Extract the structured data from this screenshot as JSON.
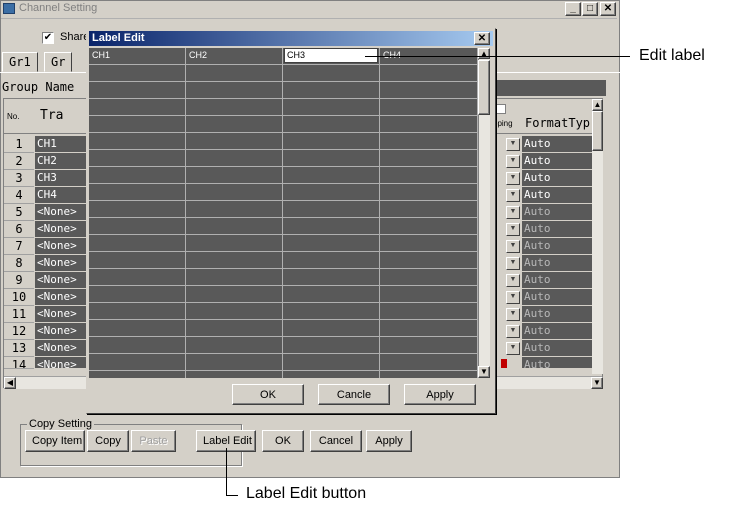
{
  "main": {
    "title": "Channel Setting",
    "share_label": "Share",
    "tabs": [
      "Gr1",
      "Gr"
    ],
    "group_name_label": "Group Name",
    "col_no": "No.",
    "col_trace": "Tra",
    "col_mapping": "pping",
    "col_format": "FormatTyp",
    "rows": [
      {
        "no": "1",
        "trace": "CH1",
        "format": "Auto"
      },
      {
        "no": "2",
        "trace": "CH2",
        "format": "Auto"
      },
      {
        "no": "3",
        "trace": "CH3",
        "format": "Auto"
      },
      {
        "no": "4",
        "trace": "CH4",
        "format": "Auto"
      },
      {
        "no": "5",
        "trace": "<None>",
        "format": "Auto"
      },
      {
        "no": "6",
        "trace": "<None>",
        "format": "Auto"
      },
      {
        "no": "7",
        "trace": "<None>",
        "format": "Auto"
      },
      {
        "no": "8",
        "trace": "<None>",
        "format": "Auto"
      },
      {
        "no": "9",
        "trace": "<None>",
        "format": "Auto"
      },
      {
        "no": "10",
        "trace": "<None>",
        "format": "Auto"
      },
      {
        "no": "11",
        "trace": "<None>",
        "format": "Auto"
      },
      {
        "no": "12",
        "trace": "<None>",
        "format": "Auto"
      },
      {
        "no": "13",
        "trace": "<None>",
        "format": "Auto"
      },
      {
        "no": "14",
        "trace": "<None>",
        "format": "Auto"
      }
    ],
    "copy_setting_label": "Copy Setting",
    "buttons": {
      "copy_item": "Copy Item",
      "copy": "Copy",
      "paste": "Paste",
      "label_edit": "Label Edit",
      "ok": "OK",
      "cancel": "Cancel",
      "apply": "Apply"
    }
  },
  "dialog": {
    "title": "Label Edit",
    "headers": [
      "CH1",
      "CH2",
      "CH3",
      "CH4"
    ],
    "edit_value": "CH3",
    "buttons": {
      "ok": "OK",
      "cancel": "Cancle",
      "apply": "Apply"
    }
  },
  "callouts": {
    "edit_label": "Edit label",
    "label_edit_button": "Label Edit button"
  },
  "colors": {
    "dialog_title_gradient_start": "#0a246a",
    "grid_cell": "#595959",
    "format_text": "#ffffff"
  }
}
